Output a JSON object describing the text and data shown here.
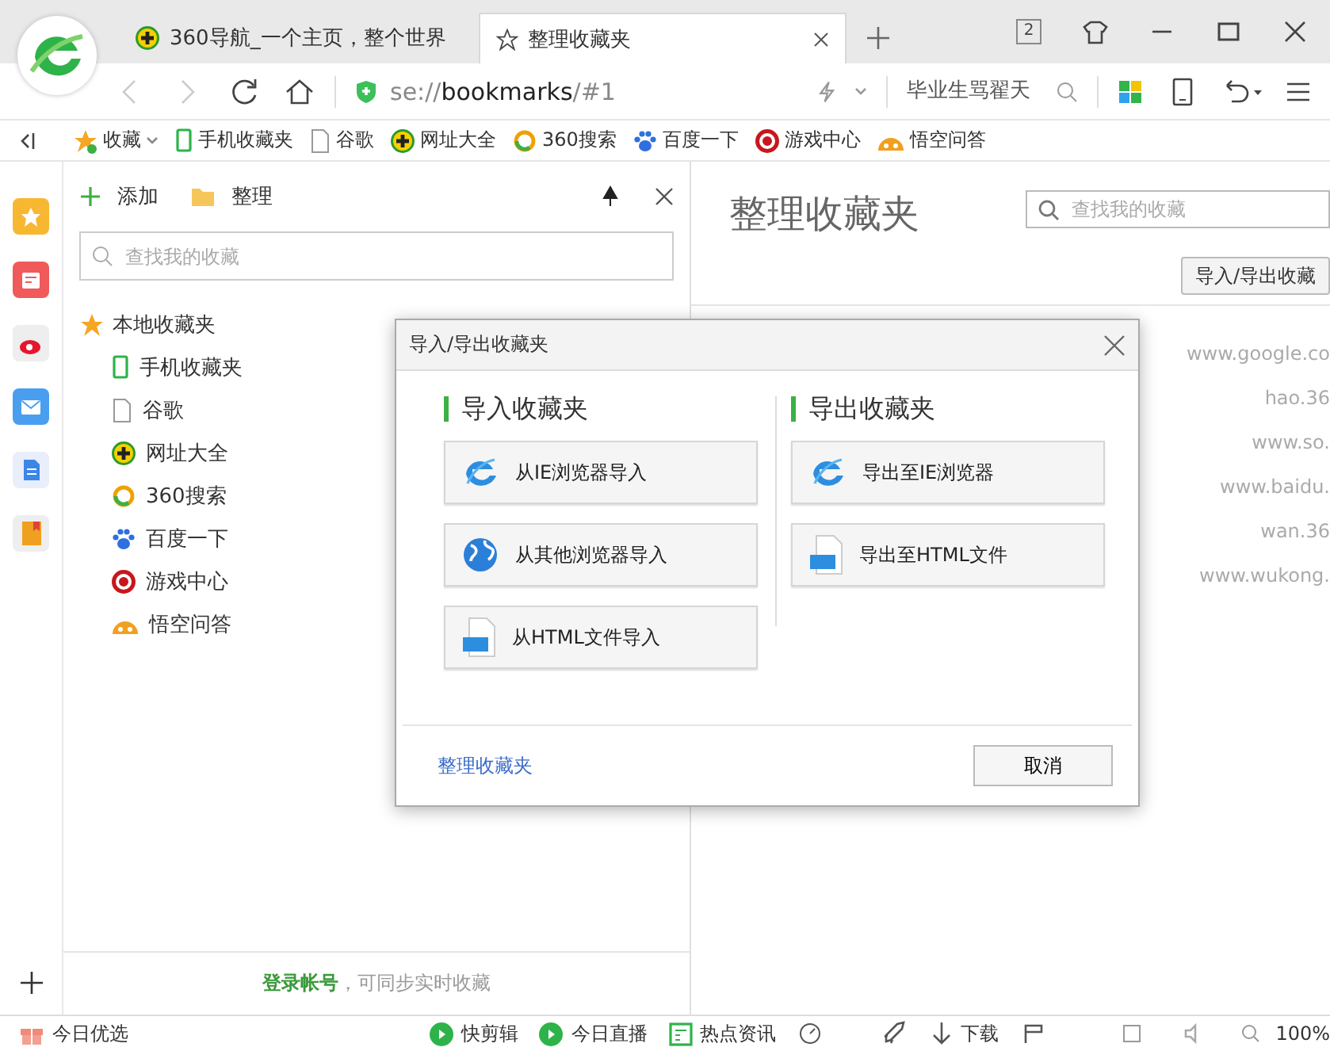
{
  "tabs": [
    {
      "title": "360导航_一个主页，整个世界",
      "selected": false
    },
    {
      "title": "整理收藏夹",
      "selected": true
    }
  ],
  "tab_count": "2",
  "address": "se://**bookmarks**/#1",
  "search": {
    "placeholder": "毕业生骂翟天"
  },
  "bookmarks_bar": {
    "menu": "收藏",
    "items": [
      "手机收藏夹",
      "谷歌",
      "网址大全",
      "360搜索",
      "百度一下",
      "游戏中心",
      "悟空问答"
    ]
  },
  "sidebar": {
    "actions": [
      "添加",
      "整理"
    ],
    "search": {
      "placeholder": "查找我的收藏"
    },
    "tree": [
      {
        "label": "本地收藏夹",
        "children": [
          {
            "label": "手机收藏夹"
          },
          {
            "label": "谷歌"
          },
          {
            "label": "网址大全"
          },
          {
            "label": "360搜索"
          },
          {
            "label": "百度一下"
          },
          {
            "label": "游戏中心"
          },
          {
            "label": "悟空问答"
          }
        ]
      }
    ],
    "login_note": "**登录帐号**，可同步实时收藏"
  },
  "content": {
    "title": "整理收藏夹",
    "search": {
      "placeholder": "查找我的收藏"
    },
    "button": "导入/导出收藏",
    "urls": [
      "www.google.co",
      "hao.36",
      "www.so.",
      "www.baidu.",
      "wan.36",
      "www.wukong."
    ]
  },
  "dialog": {
    "title": "导入/导出收藏夹",
    "sections": [
      {
        "heading": "导入收藏夹",
        "buttons": [
          {
            "label": "从IE浏览器导入",
            "kind": "ie"
          },
          {
            "label": "从其他浏览器导入",
            "kind": "browser"
          },
          {
            "label": "从HTML文件导入",
            "kind": "html"
          }
        ]
      },
      {
        "heading": "导出收藏夹",
        "buttons": [
          {
            "label": "导出至IE浏览器",
            "kind": "ie"
          },
          {
            "label": "导出至HTML文件",
            "kind": "html"
          }
        ]
      }
    ],
    "link": "整理收藏夹",
    "cancel": "取消"
  },
  "status_bar": {
    "left": "今日优选",
    "items": [
      "快剪辑",
      "今日直播",
      "热点资讯",
      "下载"
    ],
    "zoom": "100%"
  }
}
